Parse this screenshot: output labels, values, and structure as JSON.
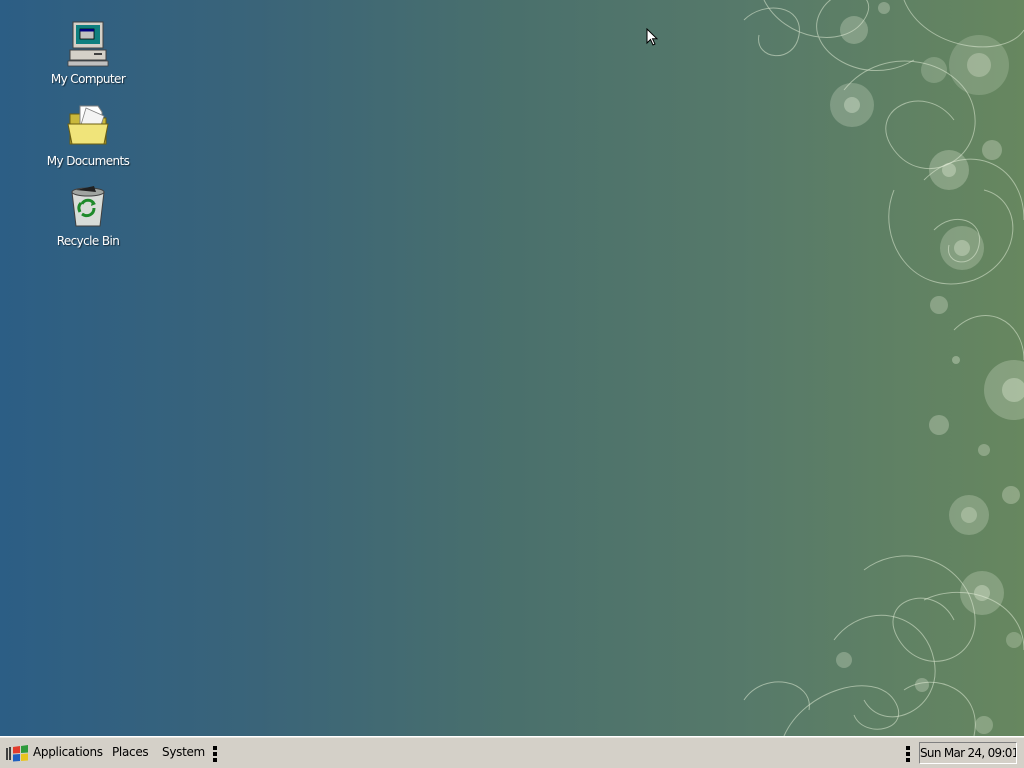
{
  "desktop": {
    "icons": [
      {
        "label": "My Computer",
        "icon": "computer-icon"
      },
      {
        "label": "My Documents",
        "icon": "folder-icon"
      },
      {
        "label": "Recycle Bin",
        "icon": "recycle-bin-icon"
      }
    ]
  },
  "taskbar": {
    "menus": [
      {
        "label": "Applications"
      },
      {
        "label": "Places"
      },
      {
        "label": "System"
      }
    ],
    "clock": "Sun Mar 24, 09:01"
  },
  "colors": {
    "taskbar_bg": "#d4d0c8",
    "desktop_left": "#2c5e85",
    "desktop_right": "#67875f"
  }
}
